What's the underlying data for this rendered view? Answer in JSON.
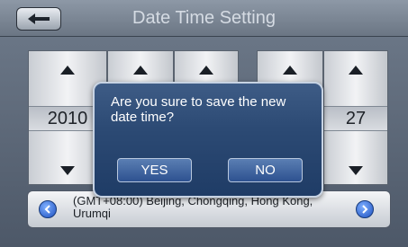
{
  "header": {
    "title": "Date Time Setting"
  },
  "spinners": {
    "year": "2010",
    "fifth": "27"
  },
  "timezone": {
    "text": "(GMT+08:00) Beijing, Chongqing, Hong Kong, Urumqi"
  },
  "dialog": {
    "message": "Are you sure to save the new date time?",
    "yes_label": "YES",
    "no_label": "NO"
  },
  "colors": {
    "dialog_bg": "#2c4a74",
    "accent_blue": "#1d4fbf"
  },
  "icons": [
    "back-arrow-icon",
    "up-arrow-icon",
    "down-arrow-icon",
    "left-circle-icon",
    "right-circle-icon"
  ]
}
